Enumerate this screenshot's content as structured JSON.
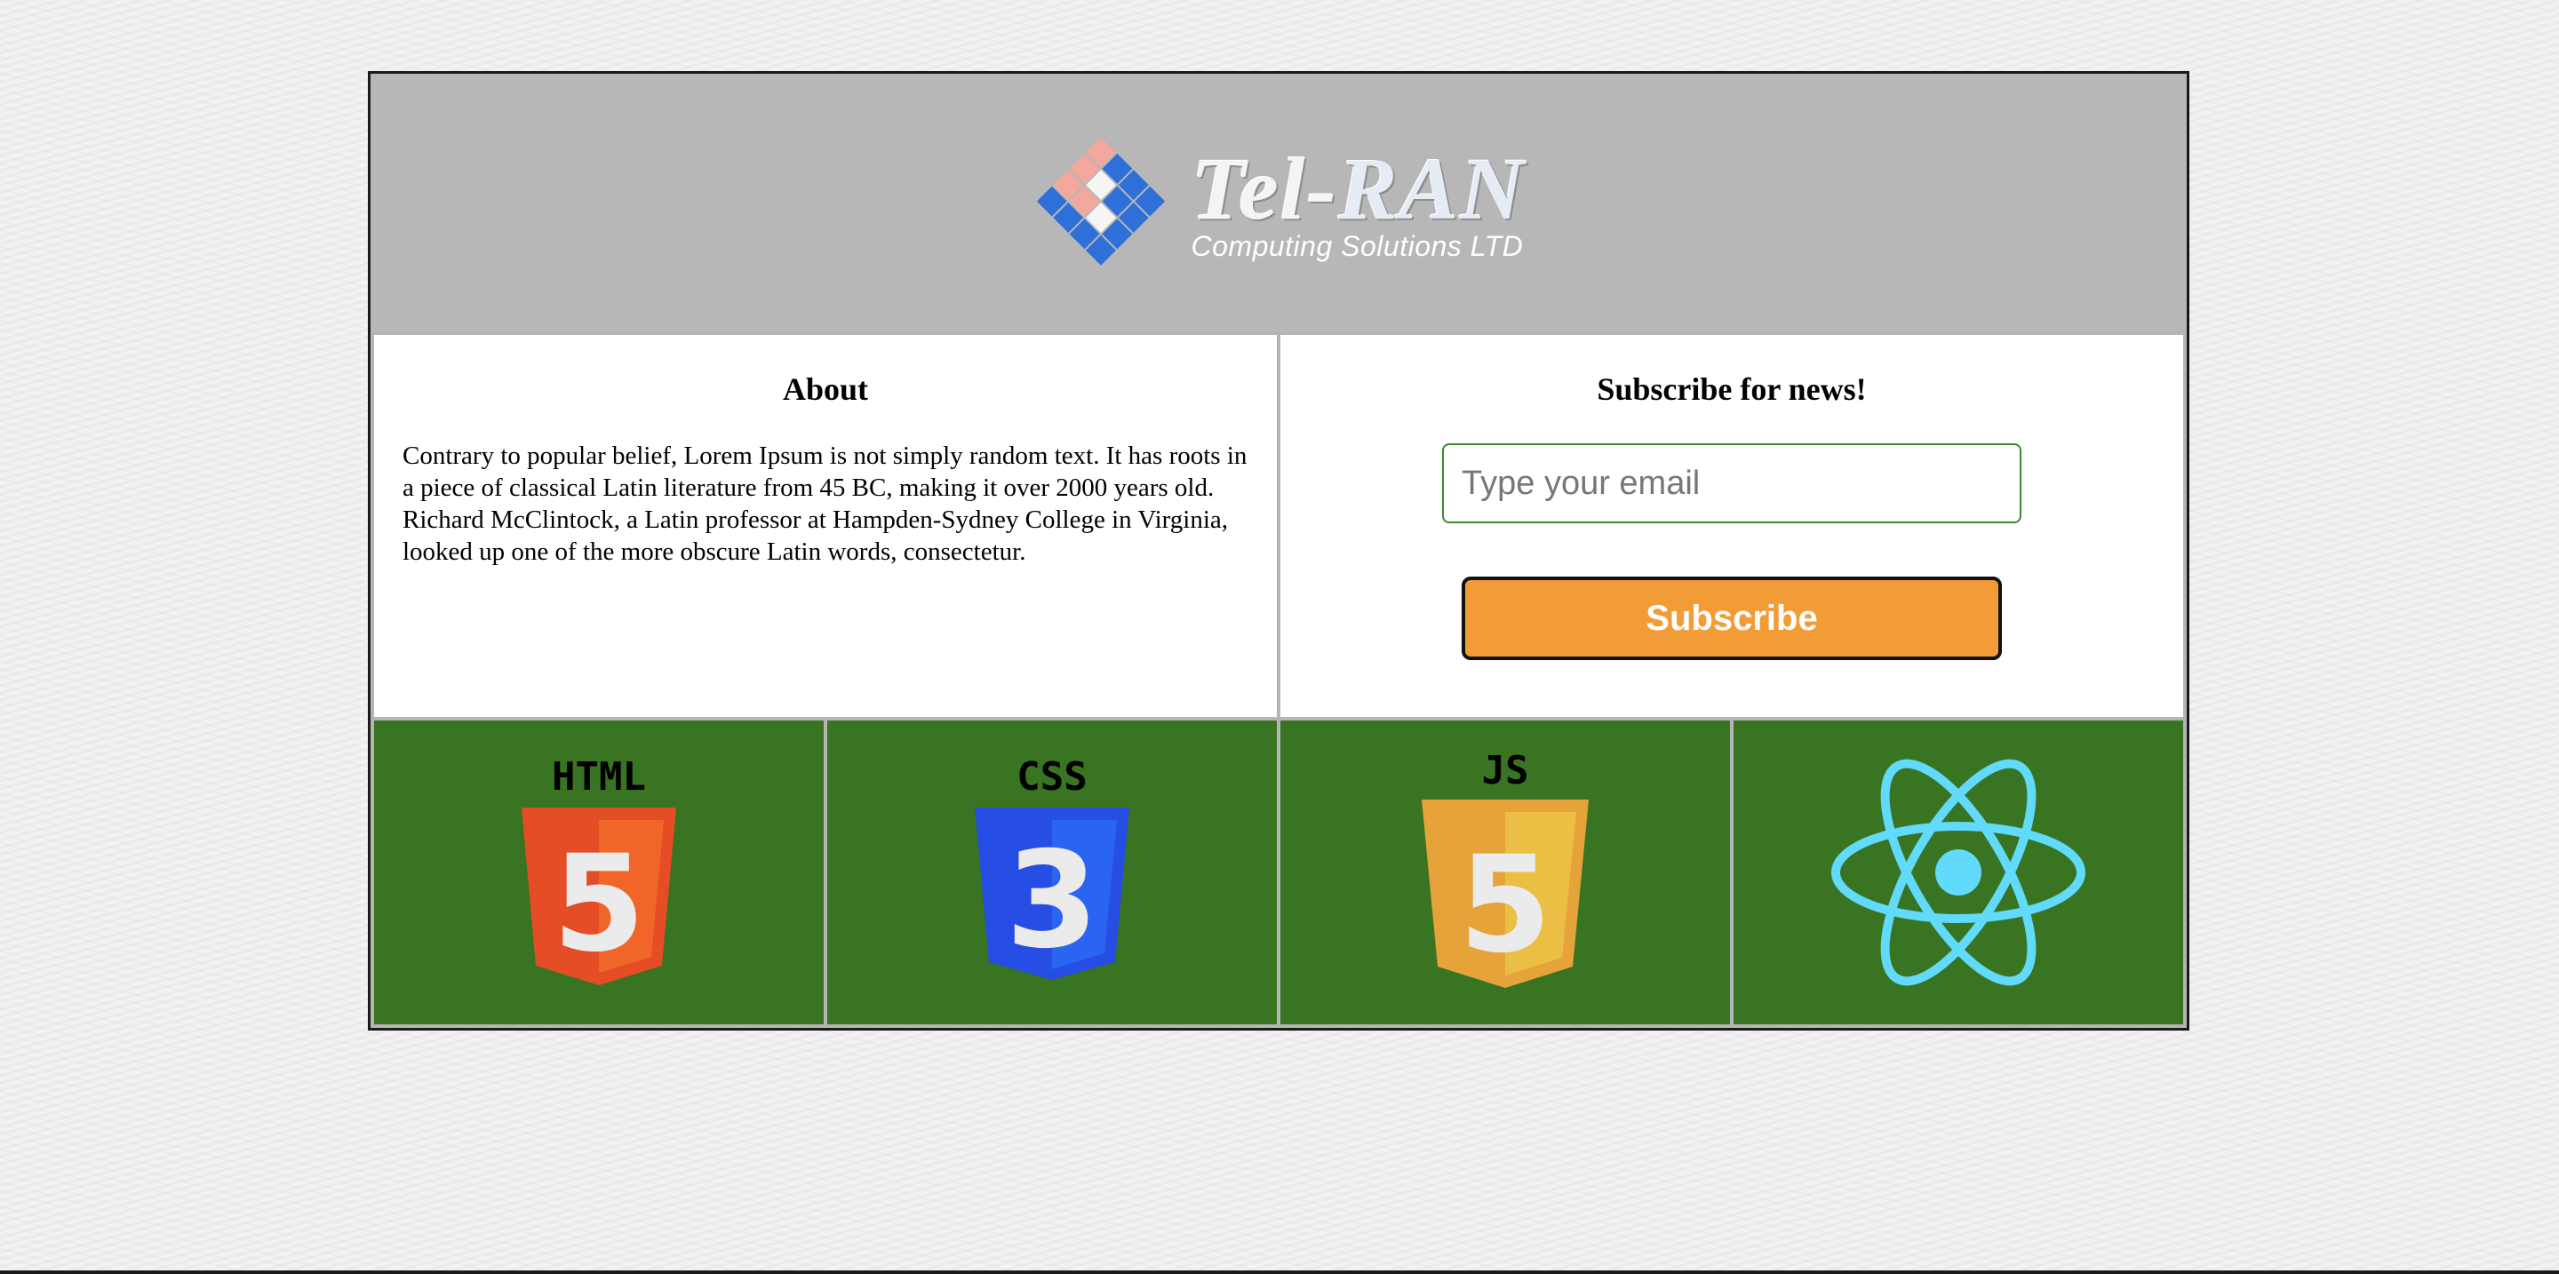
{
  "header": {
    "logo_name_part1": "Tel-",
    "logo_name_part2": "RAN",
    "logo_subtitle": "Computing Solutions LTD"
  },
  "about": {
    "title": "About",
    "text": "Contrary to popular belief, Lorem Ipsum is not simply random text. It has roots in a piece of classical Latin literature from 45 BC, making it over 2000 years old. Richard McClintock, a Latin professor at Hampden-Sydney College in Virginia, looked up one of the more obscure Latin words, consectetur."
  },
  "subscribe": {
    "title": "Subscribe for news!",
    "email_placeholder": "Type your email",
    "email_value": "",
    "button_label": "Subscribe"
  },
  "technologies": [
    {
      "label": "HTML",
      "number": "5",
      "icon": "html5-icon"
    },
    {
      "label": "CSS",
      "number": "3",
      "icon": "css3-icon"
    },
    {
      "label": "JS",
      "number": "5",
      "icon": "js-icon"
    },
    {
      "label": "",
      "icon": "react-icon"
    }
  ],
  "colors": {
    "tile_background": "#387421",
    "html_orange": "#e44d26",
    "css_blue": "#264de4",
    "js_yellow": "#e6a33a",
    "react_cyan": "#61dafb",
    "button_orange": "#f29c38",
    "input_border": "#3b8a2a"
  }
}
